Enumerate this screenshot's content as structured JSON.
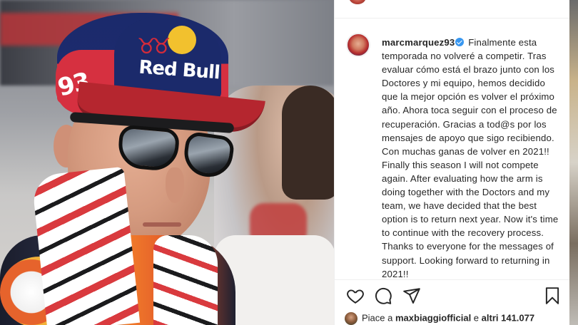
{
  "post": {
    "username": "marcmarquez93",
    "caption_es": " Finalmente esta temporada no volveré a competir. Tras evaluar cómo está el brazo junto con los Doctores y mi equipo, hemos decidido que la mejor opción es volver el próximo año. Ahora toca seguir con el proceso de recuperación. Gracias a tod@s por los mensajes de apoyo que sigo recibiendo. Con muchas ganas de volver en 2021!!",
    "caption_en": "Finally this season I will not compete again. After evaluating how the arm is doing together with the Doctors and my team, we have decided that the best option is to return next year. Now it's time to continue with the recovery process. Thanks to everyone for the messages of support. Looking forward to returning in 2021!!"
  },
  "likes": {
    "prefix": "Piace a ",
    "user": "maxbiaggiofficial",
    "middle": " e ",
    "others": "altri 141.077"
  },
  "photo": {
    "cap_number": "93",
    "cap_brand": "Red Bull"
  },
  "icons": {
    "like": "heart-icon",
    "comment": "comment-icon",
    "share": "paper-plane-icon",
    "save": "bookmark-icon",
    "verified": "verified-badge-icon"
  },
  "colors": {
    "text": "#262626",
    "verified": "#3897f0",
    "divider": "#efefef"
  }
}
